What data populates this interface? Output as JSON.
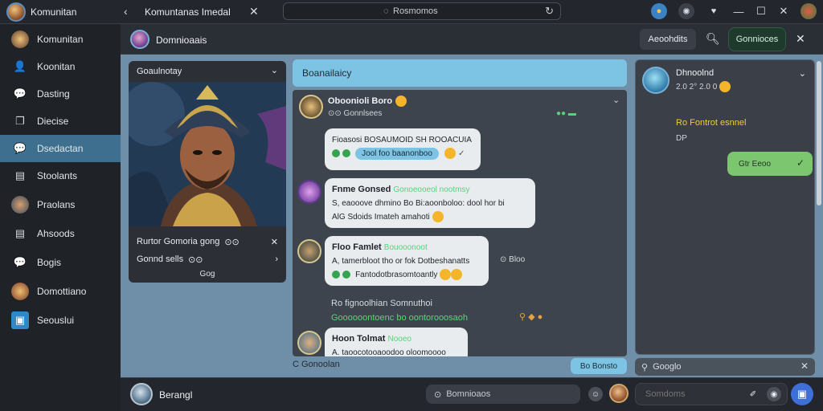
{
  "topbar": {
    "app_title": "Komunitan",
    "window_title": "Komuntanas Imedal",
    "address": "Rosmomos",
    "icons": [
      "back-icon",
      "close-icon",
      "reload-icon",
      "browser-icon",
      "settings-icon",
      "shield-icon",
      "minimize-icon",
      "maximize-icon",
      "close-icon",
      "profile-icon"
    ]
  },
  "sidebar": {
    "items": [
      {
        "label": "Komunitan",
        "icon": "avatar",
        "active": false
      },
      {
        "label": "Koonitan",
        "icon": "person-icon",
        "active": false
      },
      {
        "label": "Dasting",
        "icon": "chat-icon",
        "active": false
      },
      {
        "label": "Diecise",
        "icon": "copy-icon",
        "active": false
      },
      {
        "label": "Dsedactan",
        "icon": "chat-bubble-icon",
        "active": true
      },
      {
        "label": "Stoolants",
        "icon": "document-icon",
        "active": false
      },
      {
        "label": "Praolans",
        "icon": "avatar",
        "active": false
      },
      {
        "label": "Ahsoods",
        "icon": "document-icon",
        "active": false
      },
      {
        "label": "Bogis",
        "icon": "chat-icon",
        "active": false
      },
      {
        "label": "Domottiano",
        "icon": "avatar",
        "active": false
      },
      {
        "label": "Seouslui",
        "icon": "book-icon",
        "active": false
      }
    ]
  },
  "channel": {
    "title": "Domnioaais",
    "button1": "Aeoohdits",
    "button2": "Gonnioces"
  },
  "card": {
    "header": "Goaulnotay",
    "rows": [
      {
        "text": "Rurtor Gomoria gong",
        "badge": "⊙⊙",
        "icon": "close-icon"
      },
      {
        "text": "Gonnd sells",
        "badge": "⊙⊙",
        "icon": "chevron-right-icon"
      }
    ],
    "footer": "Gog"
  },
  "chat": {
    "header": "Boanailaicy",
    "messages": [
      {
        "name": "Oboonioli Boro",
        "sub": "⊙⊙ Gonnlsees",
        "text_line1": "Fioasosi BOSAUMOID SH ROOACUIA",
        "pill": "Jool foo baanonboo"
      },
      {
        "name": "Fnme Gonsed",
        "tag": "Gonoeooeol nootmsy",
        "text_line1": "S, eaooove dhmino Bo Bi:aoonboloo: dool hor bi",
        "text_line2": "AlG Sdoids Imateh amahoti"
      },
      {
        "name": "Floo Famlet",
        "tag": "Bouooonoot",
        "text_line1": "A, tamerbloot tho or fok Dotbeshanatts",
        "text_line2": "Fantodotbrasomtoantly"
      },
      {
        "name": "Hoon Tolmat",
        "tag": "Nooeo",
        "text_line1": "A. taoocotooaoodoo oloomoooo"
      }
    ],
    "system_line1": "Ro fignoolhian  Somnuthoi",
    "system_line2": "Goooooontoenc bo oontorooosaoh",
    "reactions": "⊙ Bloo",
    "footer_left": "C Gonoolan",
    "footer_button": "Bo Bonsto"
  },
  "right_panel": {
    "name": "Dhnoolnd",
    "sub": "2.0 2° 2.0 0",
    "highlight": "Ro Fontrot esnnel",
    "note": "DP",
    "bubble": "Gtr Eeoo",
    "search_placeholder": "Googlo"
  },
  "composer": {
    "name": "Berangl",
    "input1_placeholder": "Bomnioaos",
    "input2_placeholder": "Somdoms"
  }
}
